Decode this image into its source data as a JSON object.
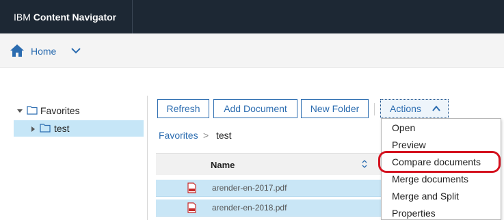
{
  "banner": {
    "ibm": "IBM",
    "product": "Content Navigator"
  },
  "nav": {
    "home_label": "Home"
  },
  "tree": {
    "items": [
      {
        "label": "Favorites"
      },
      {
        "label": "test"
      }
    ]
  },
  "toolbar": {
    "refresh_label": "Refresh",
    "add_document_label": "Add Document",
    "new_folder_label": "New Folder",
    "actions_label": "Actions"
  },
  "breadcrumb": {
    "items": [
      "Favorites",
      "test"
    ],
    "separator": ">"
  },
  "table": {
    "columns": [
      "Name"
    ],
    "rows": [
      {
        "name": "arender-en-2017.pdf"
      },
      {
        "name": "arender-en-2018.pdf"
      }
    ]
  },
  "actions_menu": {
    "items": [
      "Open",
      "Preview",
      "Compare documents",
      "Merge documents",
      "Merge and Split",
      "Properties"
    ],
    "highlighted": "Compare documents"
  },
  "colors": {
    "banner": "#1d2834",
    "accent": "#2b6cb0",
    "selection": "#c9e6f6",
    "highlight_ring": "#d4121f"
  },
  "icons": [
    "home-icon",
    "chevron-down-icon",
    "folder-icon",
    "caret-icon",
    "chevron-up-icon",
    "sort-icon",
    "pdf-icon"
  ]
}
